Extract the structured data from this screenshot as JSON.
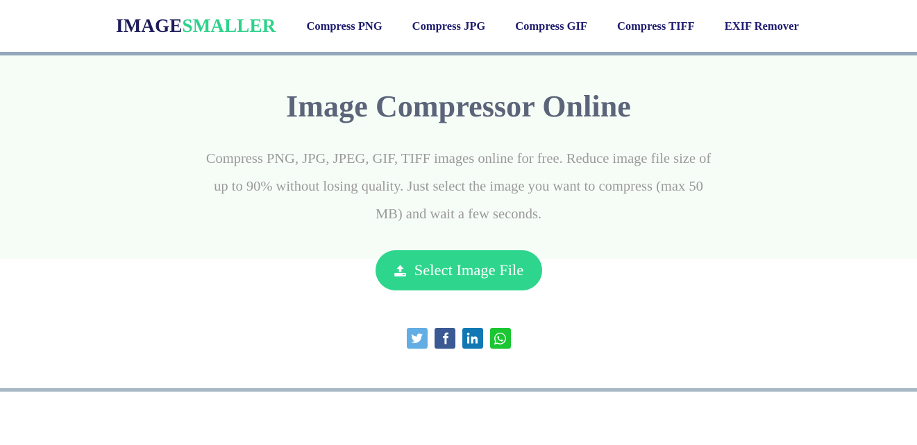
{
  "header": {
    "logo": {
      "part1": "IMAGE",
      "part2": "SMALLER",
      "color1": "#1d1b58",
      "color2": "#2fd28b"
    },
    "nav": [
      {
        "label": "Compress PNG"
      },
      {
        "label": "Compress JPG"
      },
      {
        "label": "Compress GIF"
      },
      {
        "label": "Compress TIFF"
      },
      {
        "label": "EXIF Remover"
      }
    ],
    "rule_color": "#93a8bb"
  },
  "hero": {
    "title": "Image Compressor Online",
    "description": "Compress PNG, JPG, JPEG, GIF, TIFF images online for free. Reduce image file size of up to 90% without losing quality. Just select the image you want to compress (max 50 MB) and wait a few seconds.",
    "background_color": "#f6fdf7",
    "title_color": "#5b6479",
    "description_color": "#9a9a9a",
    "cta": {
      "label": "Select Image File",
      "icon": "upload-icon",
      "background_color": "#2ed68d",
      "text_color": "#ffffff"
    }
  },
  "social": [
    {
      "name": "twitter",
      "label": "Twitter",
      "icon": "twitter-icon",
      "color": "#62aee4"
    },
    {
      "name": "facebook",
      "label": "Facebook",
      "icon": "facebook-icon",
      "color": "#3b5a93"
    },
    {
      "name": "linkedin",
      "label": "LinkedIn",
      "icon": "linkedin-icon",
      "color": "#1178b3"
    },
    {
      "name": "whatsapp",
      "label": "WhatsApp",
      "icon": "whatsapp-icon",
      "color": "#1bc632"
    }
  ],
  "footer": {
    "rule_color": "#a7b8c6"
  }
}
